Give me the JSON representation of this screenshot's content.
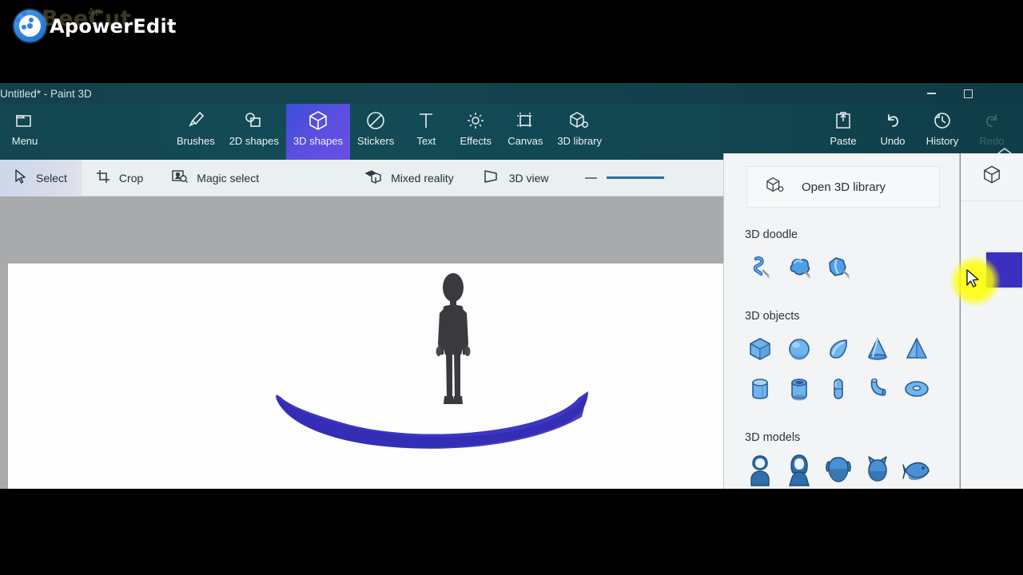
{
  "watermarks": {
    "back_label": "BeeCut",
    "back_small": "Ap",
    "front_label": "ApowerEdit",
    "logo_icon": "film-reel-icon"
  },
  "window": {
    "title": "Untitled* - Paint 3D",
    "minimize_icon": "minimize-icon",
    "maximize_icon": "maximize-icon",
    "collapse_icon": "chevron-up-icon"
  },
  "ribbon": {
    "menu": {
      "label": "Menu",
      "icon": "folder-icon"
    },
    "tools": [
      {
        "label": "Brushes",
        "icon": "paintbrush-icon",
        "active": false
      },
      {
        "label": "2D shapes",
        "icon": "2d-shapes-icon",
        "active": false
      },
      {
        "label": "3D shapes",
        "icon": "cube-icon",
        "active": true
      },
      {
        "label": "Stickers",
        "icon": "sticker-icon",
        "active": false
      },
      {
        "label": "Text",
        "icon": "text-icon",
        "active": false
      },
      {
        "label": "Effects",
        "icon": "effects-sun-icon",
        "active": false
      },
      {
        "label": "Canvas",
        "icon": "canvas-icon",
        "active": false
      },
      {
        "label": "3D library",
        "icon": "3d-library-icon",
        "active": false
      }
    ],
    "actions": [
      {
        "label": "Paste",
        "icon": "paste-icon",
        "disabled": false
      },
      {
        "label": "Undo",
        "icon": "undo-arrow-icon",
        "disabled": false
      },
      {
        "label": "History",
        "icon": "history-clock-icon",
        "disabled": false
      },
      {
        "label": "Redo",
        "icon": "redo-arrow-icon",
        "disabled": true
      }
    ]
  },
  "subbar": {
    "items": [
      {
        "label": "Select",
        "icon": "cursor-arrow-icon",
        "selected": true
      },
      {
        "label": "Crop",
        "icon": "crop-icon",
        "selected": false
      },
      {
        "label": "Magic select",
        "icon": "magic-select-icon",
        "selected": false
      },
      {
        "label": "Mixed reality",
        "icon": "mixed-reality-icon",
        "selected": false
      },
      {
        "label": "3D view",
        "icon": "3d-view-icon",
        "selected": false
      }
    ],
    "zoom": {
      "minus_icon": "zoom-out-icon",
      "slider_icon": "zoom-slider"
    }
  },
  "panel": {
    "open_library": {
      "label": "Open 3D library",
      "icon": "3d-library-icon"
    },
    "sections": [
      {
        "title": "3D doodle",
        "items": [
          {
            "name": "soft-edge-doodle",
            "icon": "doodle-tube-icon"
          },
          {
            "name": "sharp-edge-doodle",
            "icon": "doodle-soft-blob-icon"
          },
          {
            "name": "sharp-blob-doodle",
            "icon": "doodle-sharp-blob-icon"
          }
        ]
      },
      {
        "title": "3D objects",
        "items": [
          {
            "name": "cube",
            "icon": "cube-object-icon"
          },
          {
            "name": "sphere",
            "icon": "sphere-object-icon"
          },
          {
            "name": "teardrop",
            "icon": "teardrop-object-icon"
          },
          {
            "name": "cone",
            "icon": "cone-object-icon"
          },
          {
            "name": "pyramid",
            "icon": "pyramid-object-icon"
          },
          {
            "name": "cylinder",
            "icon": "cylinder-object-icon"
          },
          {
            "name": "tube",
            "icon": "tube-object-icon"
          },
          {
            "name": "capsule",
            "icon": "capsule-object-icon"
          },
          {
            "name": "elbow",
            "icon": "elbow-object-icon"
          },
          {
            "name": "donut",
            "icon": "donut-object-icon"
          }
        ]
      },
      {
        "title": "3D models",
        "items": [
          {
            "name": "man",
            "icon": "model-man-icon"
          },
          {
            "name": "woman",
            "icon": "model-woman-icon"
          },
          {
            "name": "dog",
            "icon": "model-dog-icon"
          },
          {
            "name": "cat",
            "icon": "model-cat-icon"
          },
          {
            "name": "fish",
            "icon": "model-fish-icon"
          }
        ]
      }
    ]
  },
  "rail": {
    "tool_icon": "cube-icon",
    "color_swatch": "#3a2fbe",
    "collapse_icon": "chevron-left-icon"
  },
  "canvas": {
    "figure_name": "3d-human-figure",
    "boat_name": "3d-blue-boat",
    "boat_color": "#3d37c4",
    "figure_color": "#3a3a3e"
  },
  "pointer": {
    "name": "mouse-cursor",
    "highlight_color": "#ffff00"
  }
}
